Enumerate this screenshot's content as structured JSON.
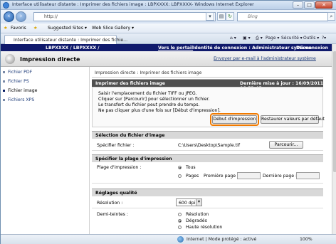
{
  "window": {
    "title": "Interface utilisateur distante : Imprimer des fichiers image : LBPXXXX: LBPXXXX- Windows Internet Explorer",
    "minimize": "–",
    "maximize": "□",
    "close": "✕"
  },
  "address": {
    "url": "http://",
    "search_placeholder": "Bing"
  },
  "favorites": {
    "label": "Favoris",
    "items": [
      "Suggested Sites ▾",
      "Web Slice Gallery ▾"
    ]
  },
  "tab": {
    "label": "Interface utilisateur distante : Imprimer des fichie..."
  },
  "commands": [
    "Page ▾",
    "Sécurité ▾",
    "Outils ▾"
  ],
  "page_header": {
    "device": "LBPXXXX / LBPXXXX /",
    "portal_link": "Vers le portail",
    "login": "Identité de connexion : Administrateur système",
    "logout": "Déconnexion",
    "app_title": "Impression directe",
    "email_link": "Envoyer par e-mail à l'administrateur système"
  },
  "sidebar": {
    "items": [
      {
        "label": "Fichier PDF"
      },
      {
        "label": "Fichier PS"
      },
      {
        "label": "Fichier image"
      },
      {
        "label": "Fichiers XPS"
      }
    ]
  },
  "main": {
    "breadcrumb": "Impression directe : Imprimer des fichiers image",
    "panel_title": "Imprimer des fichiers image",
    "last_update": "Dernière mise à jour : 16/09/2011 06:53:45",
    "instructions": [
      "Saisir l'emplacement du fichier TIFF ou JPEG.",
      "Cliquer sur [Parcourir] pour sélectionner un fichier.",
      "Le transfert du fichier peut prendre du temps.",
      "Ne pas cliquer plus d'une fois sur [Début d'impression]."
    ],
    "start_button": "Début d'impression",
    "reset_button": "Restaurer valeurs par défaut",
    "file_section": "Sélection du fichier d'image",
    "file_label": "Spécifier fichier :",
    "file_path": "C:\\Users\\Desktop\\Sample.tif",
    "browse_button": "Parcourir...",
    "range_section": "Spécifier la plage d'impression",
    "range_label": "Plage d'impression :",
    "range_all": "Tous",
    "range_pages": "Pages",
    "first_page": "Première page :",
    "last_page": "Dernière page :",
    "quality_section": "Réglages qualité",
    "resolution_label": "Résolution :",
    "resolution_value": "600 dpi",
    "halftone_label": "Demi-teintes :",
    "halftone_options": [
      "Résolution",
      "Dégradés",
      "Haute résolution"
    ]
  },
  "statusbar": {
    "zone": "Internet | Mode protégé : activé",
    "zoom": "100%"
  },
  "colors": {
    "header_navy": "#101a6c",
    "highlight_orange": "#f07a00"
  }
}
